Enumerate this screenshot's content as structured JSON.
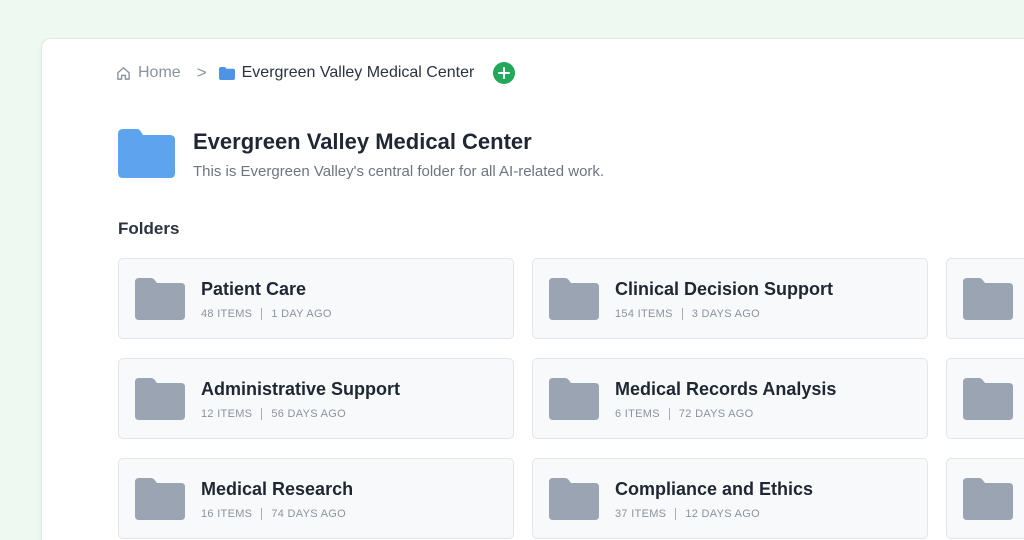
{
  "breadcrumb": {
    "home_label": "Home",
    "separator": ">",
    "current_label": "Evergreen Valley Medical Center",
    "add_icon": "plus-circle-icon"
  },
  "header": {
    "title": "Evergreen Valley Medical Center",
    "description": "This is Evergreen Valley's central folder for all AI-related work."
  },
  "folders_section": {
    "title": "Folders",
    "items": [
      {
        "name": "Patient Care",
        "items": "48 ITEMS",
        "updated": "1 DAY AGO"
      },
      {
        "name": "Clinical Decision Support",
        "items": "154 ITEMS",
        "updated": "3 DAYS AGO"
      },
      {
        "name": "Administrative Support",
        "items": "12 ITEMS",
        "updated": "56 DAYS AGO"
      },
      {
        "name": "Medical Records Analysis",
        "items": "6 ITEMS",
        "updated": "72 DAYS AGO"
      },
      {
        "name": "Medical Research",
        "items": "16 ITEMS",
        "updated": "74 DAYS AGO"
      },
      {
        "name": "Compliance and Ethics",
        "items": "37 ITEMS",
        "updated": "12 DAYS AGO"
      }
    ]
  },
  "colors": {
    "background": "#eefaf1",
    "accent_green": "#22a85a",
    "folder_blue": "#5ea3ee",
    "folder_gray": "#9aa4b3"
  }
}
